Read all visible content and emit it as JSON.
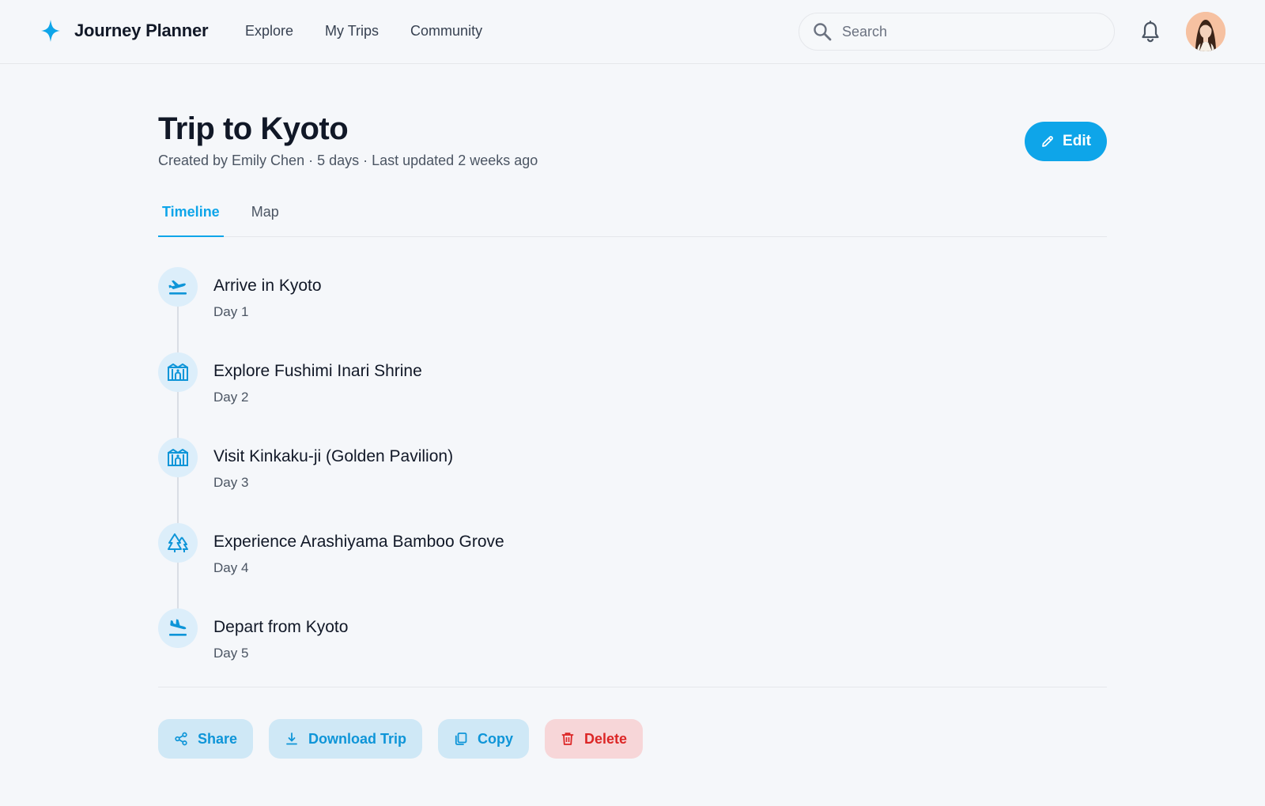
{
  "app": {
    "name": "Journey Planner",
    "accent_color": "#0ea5e9",
    "logo_icon": "sparkle-star-icon"
  },
  "nav": {
    "items": [
      {
        "label": "Explore"
      },
      {
        "label": "My Trips"
      },
      {
        "label": "Community"
      }
    ]
  },
  "search": {
    "placeholder": "Search",
    "value": "",
    "icon": "search-icon"
  },
  "header_actions": {
    "notification_icon": "bell-icon",
    "avatar": "user-avatar"
  },
  "trip": {
    "title": "Trip to Kyoto",
    "meta": "Created by Emily Chen · 5 days · Last updated 2 weeks ago",
    "edit_label": "Edit"
  },
  "tabs": [
    {
      "label": "Timeline",
      "active": true
    },
    {
      "label": "Map",
      "active": false
    }
  ],
  "timeline": [
    {
      "title": "Arrive in Kyoto",
      "day": "Day 1",
      "icon": "airplane-takeoff-icon"
    },
    {
      "title": "Explore Fushimi Inari Shrine",
      "day": "Day 2",
      "icon": "landmark-icon"
    },
    {
      "title": "Visit Kinkaku-ji (Golden Pavilion)",
      "day": "Day 3",
      "icon": "landmark-icon"
    },
    {
      "title": "Experience Arashiyama Bamboo Grove",
      "day": "Day 4",
      "icon": "forest-icon"
    },
    {
      "title": "Depart from Kyoto",
      "day": "Day 5",
      "icon": "airplane-landing-icon"
    }
  ],
  "actions": {
    "share": "Share",
    "download": "Download Trip",
    "copy": "Copy",
    "delete": "Delete",
    "danger_color": "#dc2626"
  }
}
